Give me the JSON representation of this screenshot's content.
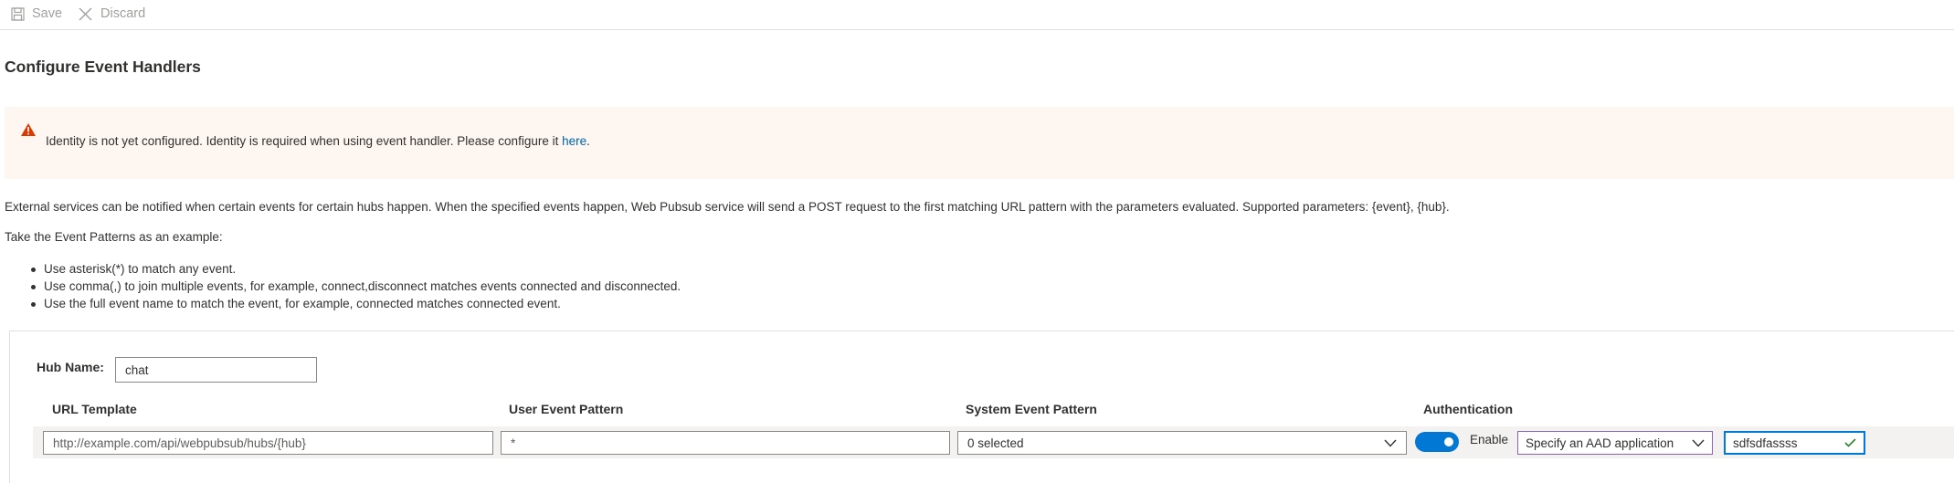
{
  "toolbar": {
    "save_label": "Save",
    "discard_label": "Discard",
    "icons": [
      "save-icon",
      "close-icon"
    ]
  },
  "page_title": "Configure Event Handlers",
  "warning": {
    "icon": "warning-icon",
    "text": "Identity is not yet configured. Identity is required when using event handler. Please configure it ",
    "link_text": "here",
    "suffix": ".",
    "colors": {
      "background": "#fdf6f1",
      "icon": "#d83b01",
      "link": "#0063b1"
    }
  },
  "description": "External services can be notified when certain events for certain hubs happen. When the specified events happen, Web Pubsub service will send a POST request to the first matching URL pattern with the parameters evaluated. Supported parameters: {event}, {hub}.",
  "example_intro": "Take the Event Patterns as an example:",
  "rules": [
    "Use asterisk(*) to match any event.",
    "Use comma(,) to join multiple events, for example, connect,disconnect matches events connected and disconnected.",
    "Use the full event name to match the event, for example, connected matches connected event."
  ],
  "hub": {
    "label": "Hub Name:",
    "value": "chat"
  },
  "columns": {
    "url_template": "URL Template",
    "user_event_pattern": "User Event Pattern",
    "system_event_pattern": "System Event Pattern",
    "authentication": "Authentication"
  },
  "handler_row": {
    "url_template_value": "http://example.com/api/webpubsub/hubs/{hub}",
    "user_event_value": "*",
    "system_event_value": "0 selected",
    "auth_enabled": true,
    "auth_toggle_label": "Enable",
    "auth_type_value": "Specify an AAD application",
    "app_id_value": "sdfsdfassss",
    "colors": {
      "toggle_on": "#0078d4",
      "valid_check": "#107c10",
      "focus_border": "#8764b8"
    }
  }
}
